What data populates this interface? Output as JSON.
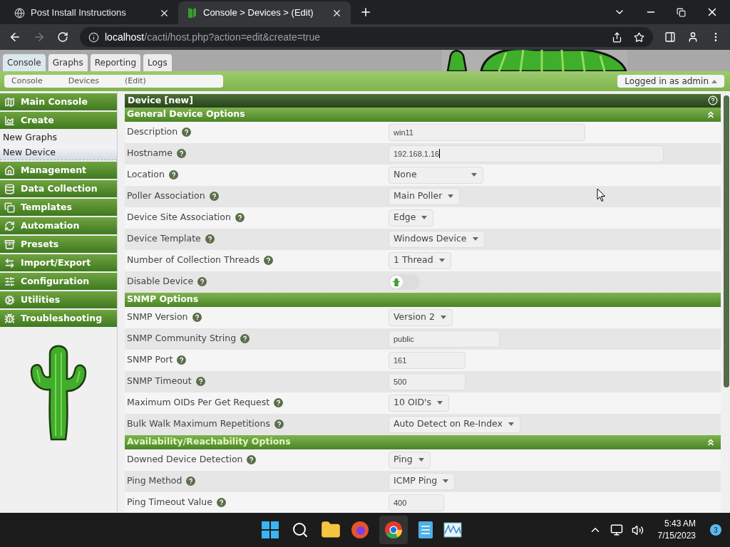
{
  "browser": {
    "tabs": [
      {
        "title": "Post Install Instructions",
        "selected": false
      },
      {
        "title": "Console > Devices > (Edit)",
        "selected": true
      }
    ],
    "url_host": "localhost",
    "url_path": "/cacti/host.php?action=edit&create=true"
  },
  "top_tabs": [
    {
      "label": "Console",
      "selected": true
    },
    {
      "label": "Graphs",
      "selected": false
    },
    {
      "label": "Reporting",
      "selected": false
    },
    {
      "label": "Logs",
      "selected": false
    }
  ],
  "breadcrumbs": [
    "Console",
    "Devices",
    "(Edit)"
  ],
  "user_menu": "Logged in as admin",
  "sidebar": [
    {
      "kind": "section",
      "label": "Main Console"
    },
    {
      "kind": "section",
      "label": "Create"
    },
    {
      "kind": "link",
      "label": "New Graphs",
      "selected": false
    },
    {
      "kind": "link",
      "label": "New Device",
      "selected": true
    },
    {
      "kind": "section",
      "label": "Management"
    },
    {
      "kind": "section",
      "label": "Data Collection"
    },
    {
      "kind": "section",
      "label": "Templates"
    },
    {
      "kind": "section",
      "label": "Automation"
    },
    {
      "kind": "section",
      "label": "Presets"
    },
    {
      "kind": "section",
      "label": "Import/Export"
    },
    {
      "kind": "section",
      "label": "Configuration"
    },
    {
      "kind": "section",
      "label": "Utilities"
    },
    {
      "kind": "section",
      "label": "Troubleshooting"
    }
  ],
  "form_title": "Device [new]",
  "sections": [
    {
      "title": "General Device Options",
      "collapsible": true,
      "fields": [
        {
          "label": "Description",
          "kind": "text",
          "value": "win11",
          "focused": false
        },
        {
          "label": "Hostname",
          "kind": "text",
          "value": "192.168.1.16",
          "focused": true
        },
        {
          "label": "Location",
          "kind": "select",
          "value": "None"
        },
        {
          "label": "Poller Association",
          "kind": "select",
          "value": "Main Poller"
        },
        {
          "label": "Device Site Association",
          "kind": "select",
          "value": "Edge"
        },
        {
          "label": "Device Template",
          "kind": "select",
          "value": "Windows Device"
        },
        {
          "label": "Number of Collection Threads",
          "kind": "select",
          "value": "1 Thread"
        },
        {
          "label": "Disable Device",
          "kind": "toggle",
          "checked": false
        }
      ]
    },
    {
      "title": "SNMP Options",
      "collapsible": false,
      "fields": [
        {
          "label": "SNMP Version",
          "kind": "select",
          "value": "Version 2"
        },
        {
          "label": "SNMP Community String",
          "kind": "text",
          "value": "public",
          "focused": false
        },
        {
          "label": "SNMP Port",
          "kind": "text",
          "value": "161",
          "focused": false
        },
        {
          "label": "SNMP Timeout",
          "kind": "text",
          "value": "500",
          "focused": false
        },
        {
          "label": "Maximum OIDs Per Get Request",
          "kind": "select",
          "value": "10 OID's"
        },
        {
          "label": "Bulk Walk Maximum Repetitions",
          "kind": "select",
          "value": "Auto Detect on Re-Index"
        }
      ]
    },
    {
      "title": "Availability/Reachability Options",
      "collapsible": true,
      "fields": [
        {
          "label": "Downed Device Detection",
          "kind": "select",
          "value": "Ping"
        },
        {
          "label": "Ping Method",
          "kind": "select",
          "value": "ICMP Ping"
        },
        {
          "label": "Ping Timeout Value",
          "kind": "text",
          "value": "400",
          "focused": false
        }
      ]
    }
  ],
  "taskbar": {
    "time": "5:43 AM",
    "date": "7/15/2023",
    "notifications": "3"
  }
}
